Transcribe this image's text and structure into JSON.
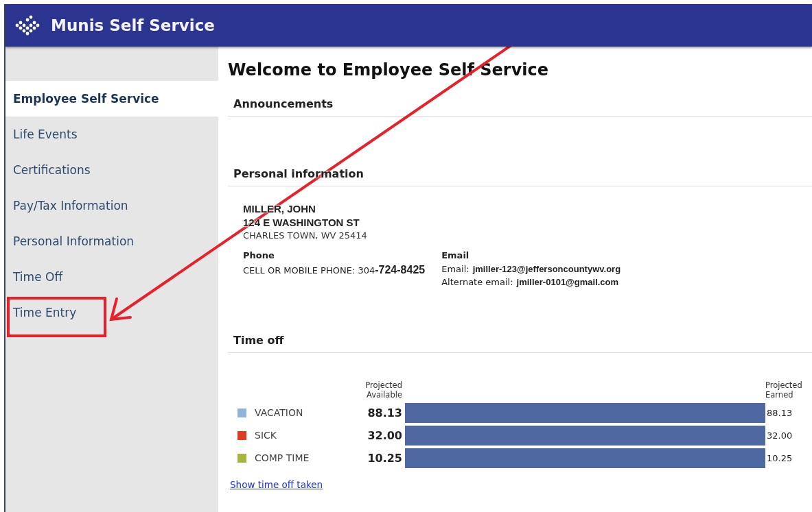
{
  "header": {
    "title": "Munis Self Service"
  },
  "sidebar": {
    "items": [
      {
        "label": "Employee Self Service",
        "selected": true
      },
      {
        "label": "Life Events",
        "selected": false
      },
      {
        "label": "Certifications",
        "selected": false
      },
      {
        "label": "Pay/Tax Information",
        "selected": false
      },
      {
        "label": "Personal Information",
        "selected": false
      },
      {
        "label": "Time Off",
        "selected": false
      },
      {
        "label": "Time Entry",
        "selected": false
      }
    ]
  },
  "main": {
    "title": "Welcome to Employee Self Service",
    "announcements": {
      "heading": "Announcements"
    },
    "personal_information": {
      "heading": "Personal information",
      "name": "MILLER, JOHN",
      "street": "124 E WASHINGTON ST",
      "city": "CHARLES TOWN, WV 25414",
      "phone": {
        "heading": "Phone",
        "label": "CELL OR MOBILE PHONE:",
        "area_code": "304",
        "number": "-724-8425"
      },
      "email": {
        "heading": "Email",
        "lines": [
          {
            "label": "Email:",
            "value": "jmiller-123@jeffersoncountywv.org"
          },
          {
            "label": "Alternate email:",
            "value": "jmiller-0101@gmail.com"
          }
        ]
      }
    },
    "time_off": {
      "heading": "Time off",
      "available_header": "Projected Available",
      "earned_header": "Projected Earned",
      "rows": [
        {
          "name": "VACATION",
          "color": "#8fb4d9",
          "available": "88.13",
          "earned": "88.13",
          "level": 1
        },
        {
          "name": "SICK",
          "color": "#e03c1f",
          "available": "32.00",
          "earned": "32.00",
          "level": 1
        },
        {
          "name": "COMP TIME",
          "color": "#a8b53c",
          "available": "10.25",
          "earned": "10.25",
          "level": 1
        }
      ],
      "link": "Show time off taken"
    }
  }
}
